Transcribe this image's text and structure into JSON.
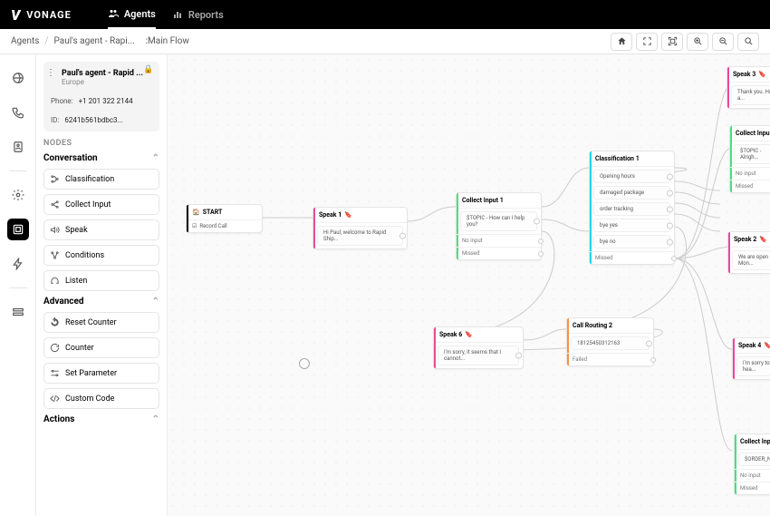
{
  "brand": "VONAGE",
  "topnav": {
    "agents": "Agents",
    "reports": "Reports"
  },
  "breadcrumb": {
    "root": "Agents",
    "agent": "Paul's agent - Rapi...",
    "flow": ":Main Flow"
  },
  "agent_card": {
    "title": "Paul's agent - Rapid ...",
    "region": "Europe",
    "phone_label": "Phone:",
    "phone_value": "+1 201 322 2144",
    "id_label": "ID:",
    "id_value": "6241b561bdbc3..."
  },
  "sections": {
    "nodes_label": "NODES",
    "conversation": "Conversation",
    "advanced": "Advanced",
    "actions": "Actions"
  },
  "conversation_nodes": {
    "classification": "Classification",
    "collect_input": "Collect Input",
    "speak": "Speak",
    "conditions": "Conditions",
    "listen": "Listen"
  },
  "advanced_nodes": {
    "reset_counter": "Reset Counter",
    "counter": "Counter",
    "set_parameter": "Set Parameter",
    "custom_code": "Custom Code"
  },
  "flow": {
    "start": {
      "title": "START",
      "row1": "Record Call"
    },
    "speak1": {
      "title": "Speak 1",
      "text": "Hi Paul, welcome to Rapid Ship..."
    },
    "collect1": {
      "title": "Collect Input 1",
      "opt1": "$TOPIC - How can I help you?",
      "sub1": "No input",
      "sub2": "Missed"
    },
    "class1": {
      "title": "Classification 1",
      "o1": "Opening hours",
      "o2": "damaged package",
      "o3": "order tracking",
      "o4": "bye yes",
      "o5": "bye no",
      "sub1": "Missed"
    },
    "speak6": {
      "title": "Speak 6",
      "text": "I'm sorry, it seems that I cannot..."
    },
    "routing2": {
      "title": "Call Routing 2",
      "opt1": "18125450312163",
      "sub1": "Failed"
    },
    "speak3": {
      "title": "Speak 3",
      "text": "Thank you. Have a..."
    },
    "collect2": {
      "title": "Collect Inpu",
      "opt1": "$TOPIC - Alrigh...",
      "sub1": "No input",
      "sub2": "Missed"
    },
    "speak2": {
      "title": "Speak 2",
      "text": "We are open Mon..."
    },
    "speak4": {
      "title": "Speak 4",
      "text": "I'm sorry to hea..."
    },
    "collect3": {
      "title": "Collect Inp",
      "opt1": "$ORDER_NO...",
      "sub1": "No input",
      "sub2": "Missed"
    }
  }
}
